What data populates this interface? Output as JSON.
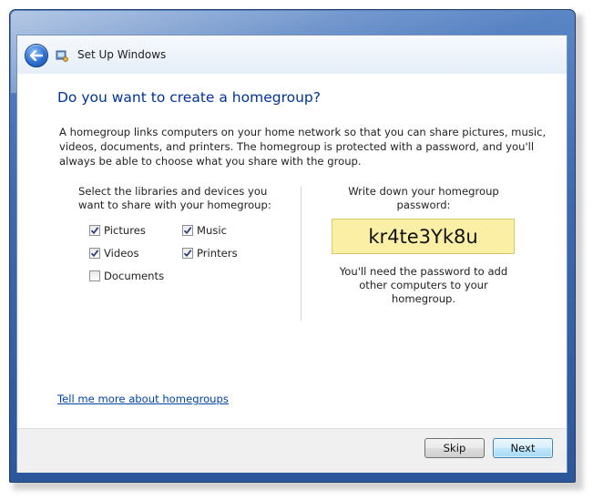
{
  "window": {
    "title": "Set Up Windows",
    "heading": "Do you want to create a homegroup?",
    "intro": "A homegroup links computers on your home network so that you can share pictures, music, videos, documents, and printers. The homegroup is protected with a password, and you'll always be able to choose what you share with the group."
  },
  "libraries": {
    "label": "Select the libraries and devices you want to share with your homegroup:",
    "items": [
      {
        "label": "Pictures",
        "checked": true
      },
      {
        "label": "Music",
        "checked": true
      },
      {
        "label": "Videos",
        "checked": true
      },
      {
        "label": "Printers",
        "checked": true
      },
      {
        "label": "Documents",
        "checked": false
      }
    ]
  },
  "password": {
    "label": "Write down your homegroup password:",
    "value": "kr4te3Yk8u",
    "note": "You'll need the password to add other computers to your homegroup."
  },
  "help_link": "Tell me more about homegroups",
  "buttons": {
    "skip": "Skip",
    "next": "Next"
  },
  "icons": {
    "back": "back-arrow-icon",
    "app": "setup-windows-icon",
    "check": "checkmark-icon"
  },
  "colors": {
    "heading": "#003399",
    "password_bg": "#fbefa6",
    "link": "#0044aa",
    "frame": "#3d6aae"
  }
}
